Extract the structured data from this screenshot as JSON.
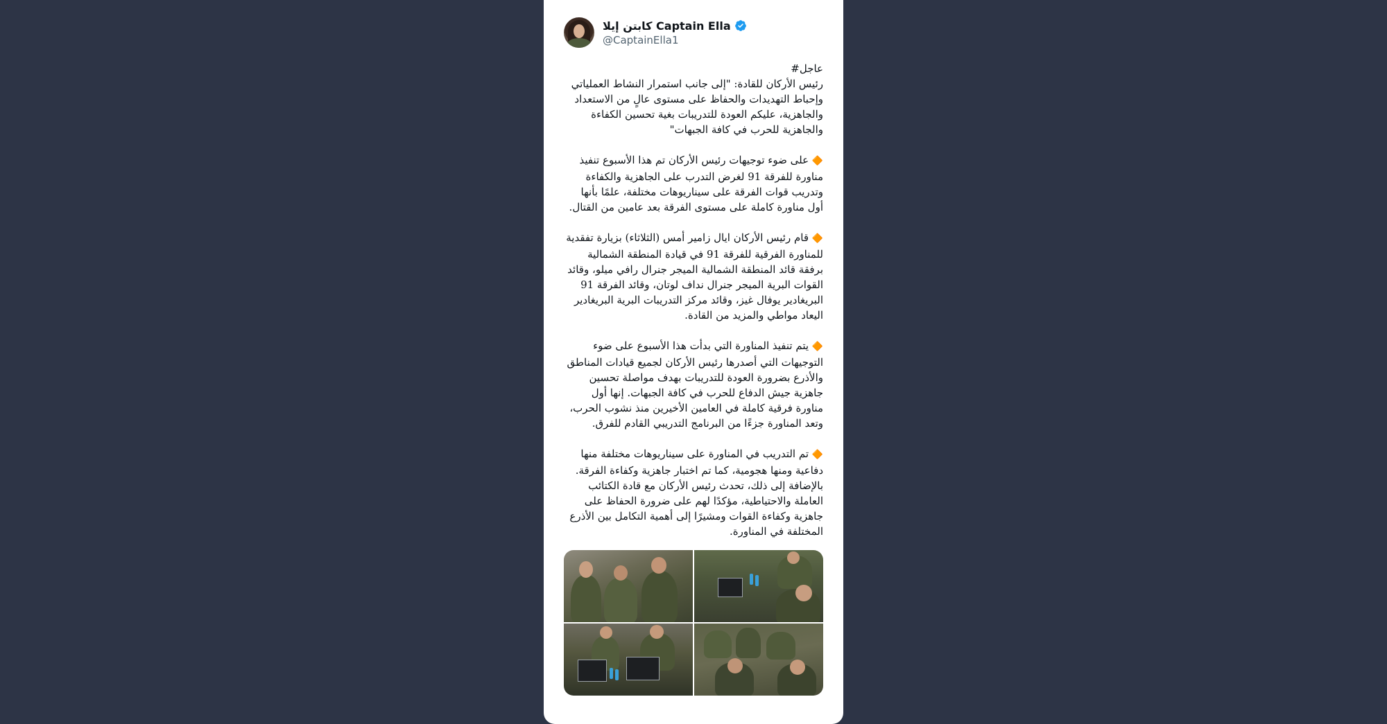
{
  "tweet": {
    "display_name": "كابتن إيلا Captain Ella",
    "handle": "@CaptainElla1",
    "verified_icon": "verified-badge-icon",
    "accent_color": "#1d9bf0",
    "hashtag": "عاجل#",
    "intro": "رئيس الأركان للقادة: \"إلى جانب استمرار النشاط العملياتي وإحباط التهديدات والحفاظ على مستوى عالٍ من الاستعداد والجاهزية، عليكم العودة للتدريبات بغية تحسين الكفاءة والجاهزية للحرب في كافة الجبهات\"",
    "bullet_icon": "🔶",
    "bullet_color": "#f5820b",
    "paragraphs": [
      "على ضوء توجيهات رئيس الأركان تم هذا الأسبوع تنفيذ مناورة للفرقة 91 لغرض التدرب على الجاهزية والكفاءة وتدريب قوات الفرقة على سيناريوهات مختلفة، علمًا بأنها أول مناورة كاملة على مستوى الفرقة بعد عامين من القتال.",
      "قام رئيس الأركان ايال زامير أمس (الثلاثاء) بزيارة تفقدية للمناورة الفرقية للفرقة 91 في قيادة المنطقة الشمالية برفقة قائد المنطقة الشمالية الميجر جنرال رافي ميلو، وقائد القوات البرية الميجر جنرال نداف لوتان، وقائد الفرقة 91 البريغادير يوفال غيز، وقائد مركز التدريبات البرية البريغادير اليعاد مواطي والمزيد من القادة.",
      "يتم تنفيذ المناورة التي بدأت هذا الأسبوع على ضوء التوجيهات التي أصدرها رئيس الأركان لجميع قيادات المناطق والأذرع بضرورة العودة للتدريبات بهدف مواصلة تحسين جاهزية جيش الدفاع للحرب في كافة الجبهات. إنها أول مناورة فرقية كاملة في العامين الأخيرين منذ نشوب الحرب، وتعد المناورة جزءًا من البرنامج التدريبي القادم للفرق.",
      "تم التدريب في المناورة على سيناريوهات مختلفة منها دفاعية ومنها هجومية، كما تم اختبار جاهزية وكفاءة الفرقة. بالإضافة إلى ذلك، تحدث رئيس الأركان مع قادة الكتائب العاملة والاحتياطية، مؤكدًا لهم على ضرورة الحفاظ على جاهزية وكفاءة القوات ومشيرًا إلى أهمية التكامل بين الأذرع المختلفة في المناورة."
    ],
    "photos": [
      "soldiers-briefing-photo",
      "field-command-laptops-photo",
      "officers-at-laptops-photo",
      "commanders-seated-photo"
    ]
  },
  "colors": {
    "page_background": "#2d3446",
    "card_background": "#ffffff",
    "handle_color": "#536471"
  }
}
